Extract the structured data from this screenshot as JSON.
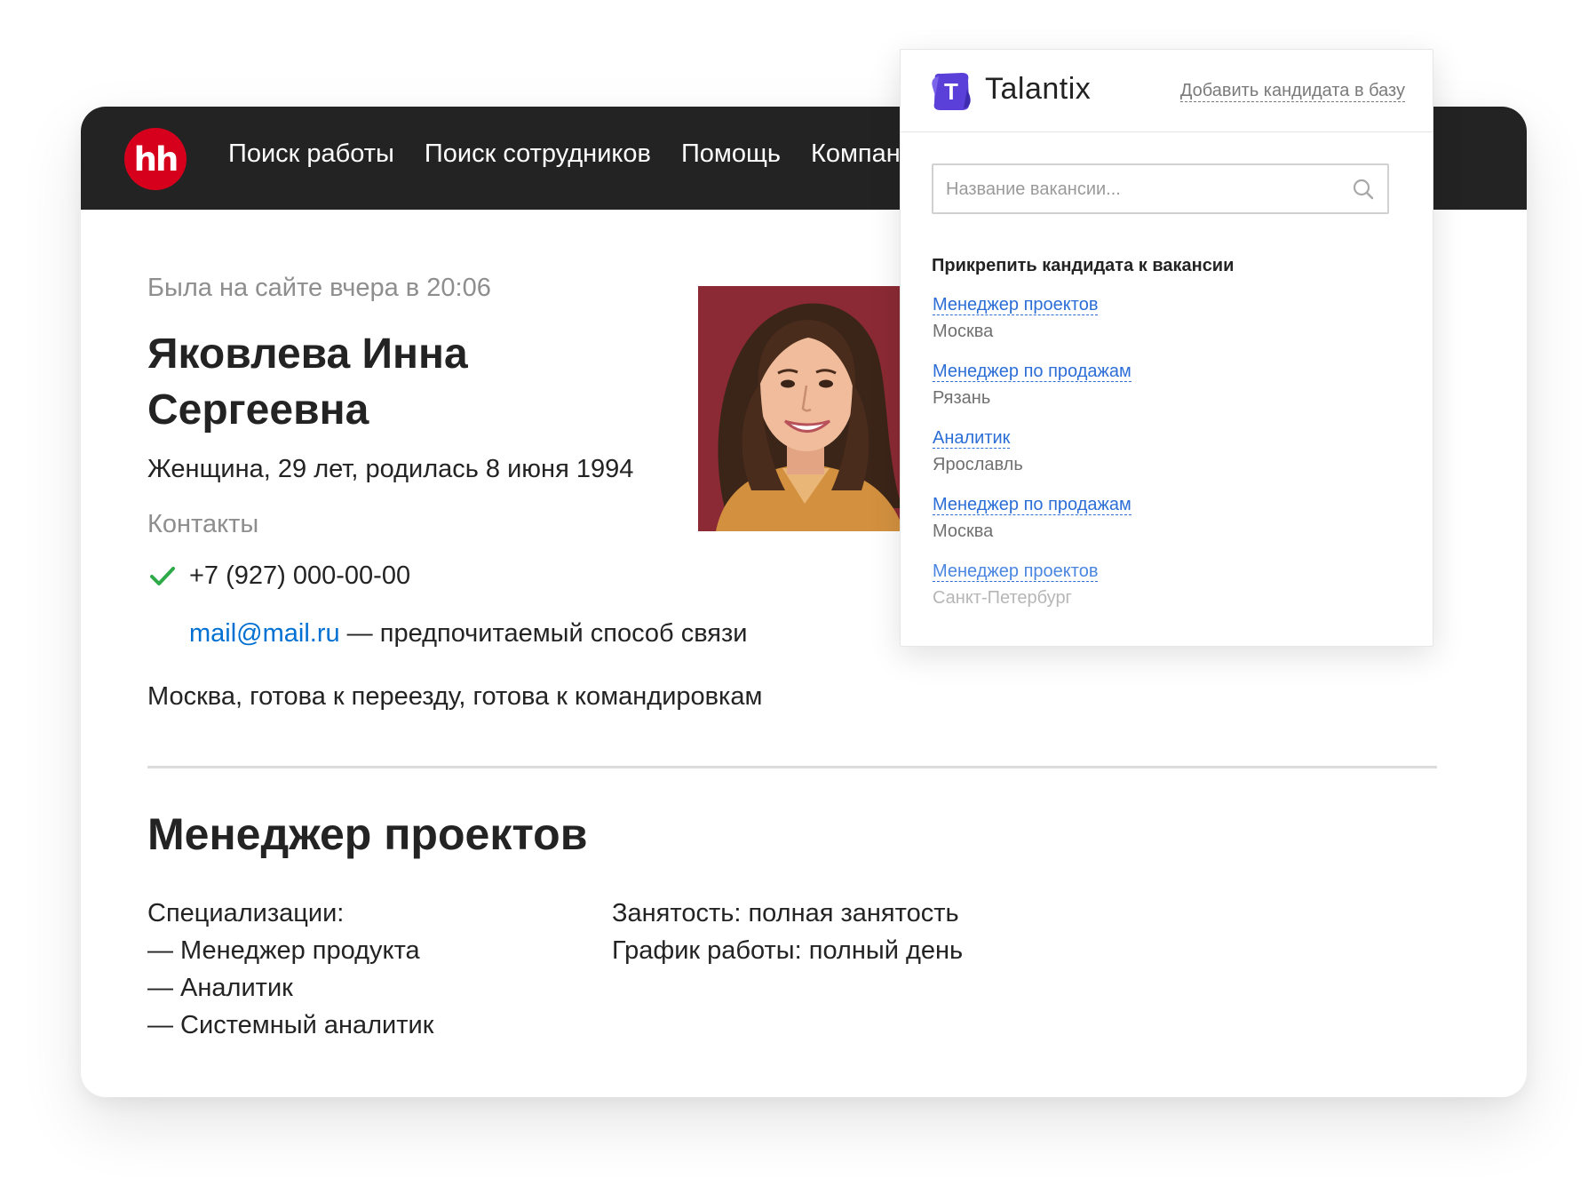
{
  "site": {
    "logo_text": "hh",
    "nav": [
      "Поиск работы",
      "Поиск сотрудников",
      "Помощь",
      "Компания"
    ]
  },
  "profile": {
    "last_seen": "Была на сайте вчера в 20:06",
    "name": "Яковлева Инна Сергеевна",
    "bio": "Женщина, 29 лет, родилась 8 июня 1994",
    "contacts_label": "Контакты",
    "phone": "+7 (927) 000-00-00",
    "email": "mail@mail.ru",
    "email_note": " — предпочитаемый способ связи",
    "location": "Москва, готова к переезду, готова к командировкам"
  },
  "resume": {
    "position": "Менеджер проектов",
    "specializations_label": "Специализации:",
    "specializations": [
      "— Менеджер продукта",
      "— Аналитик",
      "— Системный аналитик"
    ],
    "employment": "Занятость: полная занятость",
    "schedule": "График работы: полный день"
  },
  "talantix": {
    "brand": "Talantix",
    "logo_letter": "T",
    "add_candidate": "Добавить кандидата в базу",
    "search_placeholder": "Название вакансии...",
    "attach_title": "Прикрепить кандидата к вакансии",
    "vacancies": [
      {
        "title": "Менеджер проектов",
        "city": "Москва"
      },
      {
        "title": "Менеджер по продажам",
        "city": "Рязань"
      },
      {
        "title": "Аналитик",
        "city": "Ярославль"
      },
      {
        "title": "Менеджер по продажам",
        "city": "Москва"
      },
      {
        "title": "Менеджер проектов",
        "city": "Санкт-Петербург"
      }
    ]
  },
  "colors": {
    "topbar": "#232323",
    "hh_red": "#d6001c",
    "link_blue": "#0070d2",
    "talantix_purple": "#5a3fd8",
    "check_green": "#2eaa48"
  }
}
